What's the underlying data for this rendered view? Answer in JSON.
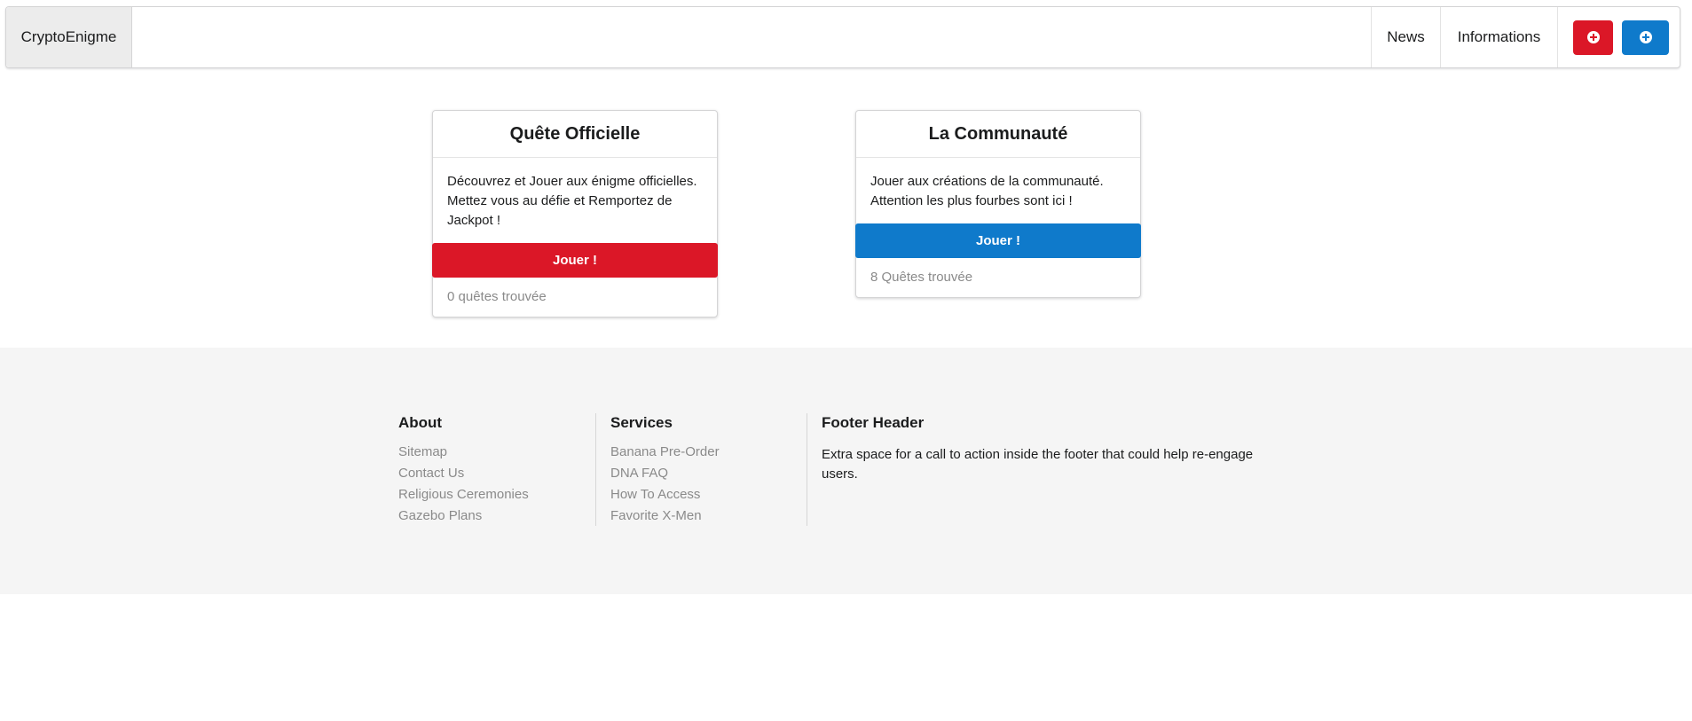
{
  "navbar": {
    "brand": "CryptoEnigme",
    "items": [
      {
        "label": "News"
      },
      {
        "label": "Informations"
      }
    ],
    "actions": [
      {
        "icon": "plus-circle-icon",
        "color": "#db1727"
      },
      {
        "icon": "plus-circle-icon",
        "color": "#0f7acb"
      }
    ]
  },
  "cards": [
    {
      "title": "Quête Officielle",
      "description": "Découvrez et Jouer aux énigme officielles. Mettez vous au défie et Remportez de Jackpot !",
      "button": "Jouer !",
      "button_color": "#db1727",
      "meta": "0 quêtes trouvée"
    },
    {
      "title": "La Communauté",
      "description": "Jouer aux créations de la communauté. Attention les plus fourbes sont ici !",
      "button": "Jouer !",
      "button_color": "#0f7acb",
      "meta": "8 Quêtes trouvée"
    }
  ],
  "footer": {
    "about": {
      "header": "About",
      "links": [
        "Sitemap",
        "Contact Us",
        "Religious Ceremonies",
        "Gazebo Plans"
      ]
    },
    "services": {
      "header": "Services",
      "links": [
        "Banana Pre-Order",
        "DNA FAQ",
        "How To Access",
        "Favorite X-Men"
      ]
    },
    "cta": {
      "header": "Footer Header",
      "text": "Extra space for a call to action inside the footer that could help re-engage users."
    }
  }
}
